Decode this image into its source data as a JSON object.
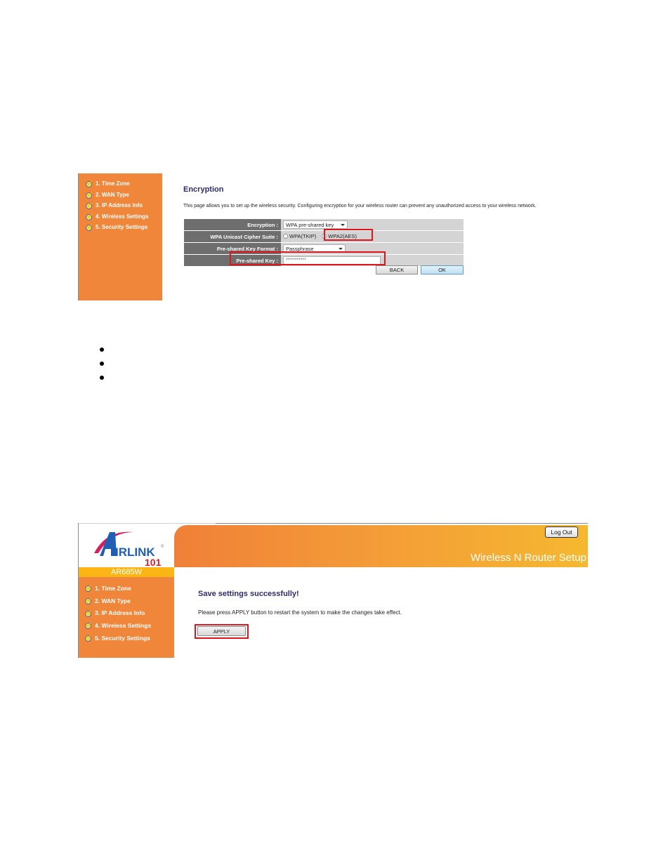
{
  "encryption_screen": {
    "sidebar": {
      "items": [
        {
          "label": "1. Time Zone"
        },
        {
          "label": "2. WAN Type"
        },
        {
          "label": "3. IP Address Info"
        },
        {
          "label": "4. Wireless Settings"
        },
        {
          "label": "5. Security Settings"
        }
      ]
    },
    "title": "Encryption",
    "description": "This page allows you to set up the wireless security. Configuring encryption for your wireless router can prevent any unauthorized access to your wireless network.",
    "form": {
      "encryption": {
        "label": "Encryption :",
        "value": "WPA pre-shared key"
      },
      "cipher_suite": {
        "label": "WPA Unicast Cipher Suite :",
        "options": [
          {
            "label": "WPA(TKIP)",
            "selected": false
          },
          {
            "label": "WPA2(AES)",
            "selected": true
          }
        ]
      },
      "key_format": {
        "label": "Pre-shared Key Format :",
        "value": "Passphrase"
      },
      "key": {
        "label": "Pre-shared Key :",
        "value": "***********"
      }
    },
    "buttons": {
      "back": "BACK",
      "ok": "OK"
    },
    "highlight_color": "#e0141b"
  },
  "bullets": [
    "",
    "",
    ""
  ],
  "save_screen": {
    "logo": {
      "brand": "AIRLINK",
      "sub": "101",
      "registered": "®"
    },
    "model": "AR685W",
    "banner_title": "Wireless N Router Setup",
    "logout_label": "Log Out",
    "sidebar": {
      "items": [
        {
          "label": "1. Time Zone"
        },
        {
          "label": "2. WAN Type"
        },
        {
          "label": "3. IP Address Info"
        },
        {
          "label": "4. Wireless Settings"
        },
        {
          "label": "5. Security Settings"
        }
      ]
    },
    "title": "Save settings successfully!",
    "description": "Please press APPLY button to restart the system to make the changes take effect.",
    "apply_label": "APPLY"
  },
  "colors": {
    "sidebar_orange": "#f0863a",
    "model_bar": "#fbb615",
    "label_gray": "#6e6e6e",
    "title_navy": "#2d2a6e"
  }
}
